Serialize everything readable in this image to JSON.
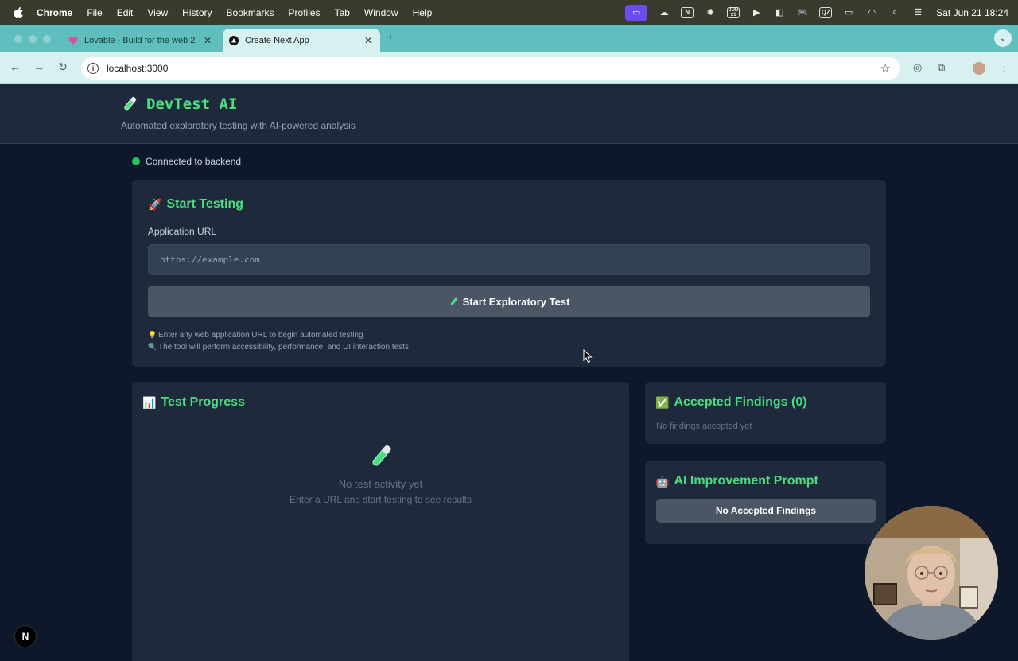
{
  "menubar": {
    "app": "Chrome",
    "items": [
      "File",
      "Edit",
      "View",
      "History",
      "Bookmarks",
      "Profiles",
      "Tab",
      "Window",
      "Help"
    ],
    "calendar_month": "JUN",
    "calendar_day": "21",
    "qz_label": "QZ",
    "clock": "Sat Jun 21  18:24"
  },
  "tabs": [
    {
      "title": "Lovable - Build for the web 2",
      "active": false
    },
    {
      "title": "Create Next App",
      "active": true
    }
  ],
  "toolbar": {
    "url": "localhost:3000"
  },
  "header": {
    "title": "DevTest AI",
    "subtitle": "Automated exploratory testing with AI-powered analysis"
  },
  "connection": {
    "status": "Connected to backend",
    "color": "#22c55e"
  },
  "start_card": {
    "title": "Start Testing",
    "title_emoji": "🚀",
    "url_label": "Application URL",
    "url_placeholder": "https://example.com",
    "start_button": "Start Exploratory Test",
    "tips": [
      {
        "icon": "💡",
        "text": "Enter any web application URL to begin automated testing"
      },
      {
        "icon": "🔍",
        "text": "The tool will perform accessibility, performance, and UI interaction tests"
      }
    ]
  },
  "progress_card": {
    "title": "Test Progress",
    "title_emoji": "📊",
    "empty_title": "No test activity yet",
    "empty_subtitle": "Enter a URL and start testing to see results"
  },
  "findings_card": {
    "title": "Accepted Findings (0)",
    "title_emoji": "✅",
    "empty": "No findings accepted yet"
  },
  "prompt_card": {
    "title": "AI Improvement Prompt",
    "title_emoji": "🤖",
    "button": "No Accepted Findings"
  },
  "next_badge": "N",
  "colors": {
    "accent_green": "#4ade80",
    "page_bg": "#0f172a",
    "card_bg": "#1e293b",
    "tab_strip": "#5fbfbf"
  }
}
